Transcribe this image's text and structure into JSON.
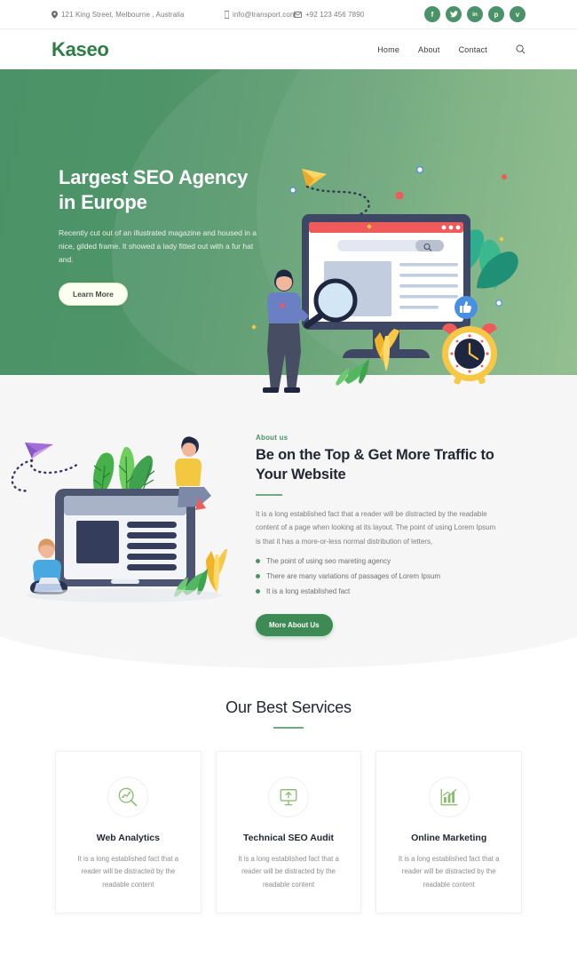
{
  "topbar": {
    "address": "121 King Street, Melbourne , Australia",
    "address_icon": "location-pin-icon",
    "email": "info@transport.com",
    "email_icon": "mobile-icon",
    "phone": "+92 123 456 7890",
    "phone_icon": "envelope-icon",
    "socials": [
      {
        "name": "facebook",
        "glyph": "f"
      },
      {
        "name": "twitter",
        "glyph": "✓"
      },
      {
        "name": "linkedin",
        "glyph": "in"
      },
      {
        "name": "pinterest",
        "glyph": "p"
      },
      {
        "name": "vimeo",
        "glyph": "v"
      }
    ],
    "social_bg": "#4a9268"
  },
  "header": {
    "logo": "Kaseo",
    "logo_color": "#2e7d45",
    "nav": [
      {
        "label": "Home"
      },
      {
        "label": "About"
      },
      {
        "label": "Contact"
      }
    ],
    "search_icon": "search-icon"
  },
  "hero": {
    "title": "Largest SEO Agency in Europe",
    "paragraph": "Recently cut out of an illustrated magazine and housed in a nice, gilded frame. It showed a lady fitted out with a fur hat and.",
    "cta": "Learn More",
    "bg_color_start": "#4a9268",
    "bg_color_end": "#8fbd88"
  },
  "about": {
    "eyebrow": "About us",
    "title": "Be on the Top & Get More Traffic to Your Website",
    "paragraph": "It is a long established fact that a reader will be distracted by the readable content of a page when looking at its layout. The point of using Lorem Ipsum is that it has a more-or-less normal distribution of letters,",
    "bullets": [
      "The point of using seo mareting agency",
      "There are many variations of passages of Lorem Ipsum",
      "It is a long established fact"
    ],
    "cta": "More About Us",
    "accent": "#3e8a55"
  },
  "services": {
    "title": "Our Best Services",
    "cards": [
      {
        "icon": "analytics-magnifier-icon",
        "title": "Web Analytics",
        "text": "It is a long established fact that a reader will be distracted by the readable content"
      },
      {
        "icon": "monitor-upload-icon",
        "title": "Technical SEO Audit",
        "text": "It is a long established fact that a reader will be distracted by the readable content"
      },
      {
        "icon": "bar-chart-growth-icon",
        "title": "Online Marketing",
        "text": "It is a long established fact that a reader will be distracted by the readable content"
      }
    ],
    "icon_color": "#86bb6a"
  }
}
